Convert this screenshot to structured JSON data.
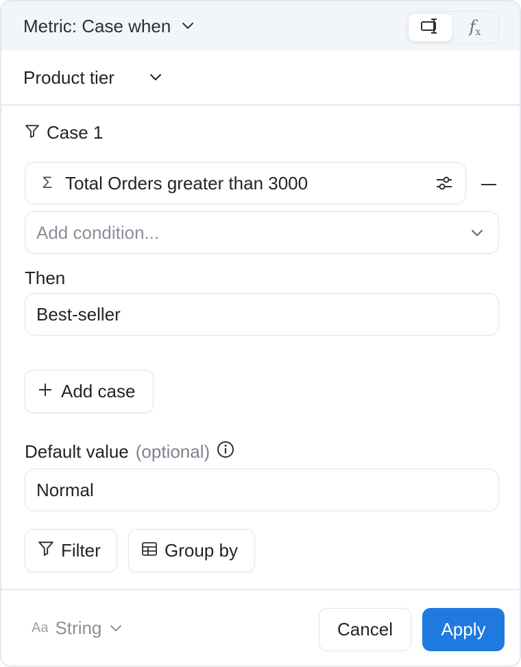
{
  "header": {
    "title": "Metric: Case when",
    "modes": [
      {
        "name": "visual-builder-icon",
        "active": true
      },
      {
        "name": "formula-fx-icon",
        "active": false,
        "glyph_main": "f",
        "glyph_sub": "x"
      }
    ]
  },
  "column": {
    "label": "Product tier"
  },
  "case": {
    "title": "Case 1",
    "condition": "Total Orders greater than 3000",
    "add_condition_placeholder": "Add condition...",
    "then_label": "Then",
    "then_value": "Best-seller"
  },
  "add_case_label": "Add case",
  "default": {
    "label": "Default value",
    "optional": "(optional)",
    "value": "Normal"
  },
  "filter_label": "Filter",
  "groupby_label": "Group by",
  "footer": {
    "type_icon": "Aa",
    "type_label": "String",
    "cancel_label": "Cancel",
    "apply_label": "Apply"
  },
  "colors": {
    "accent": "#1f7ae0",
    "header_bg": "#f3f6f9",
    "border": "#dfe3e8",
    "muted_text": "#8a8f98"
  }
}
